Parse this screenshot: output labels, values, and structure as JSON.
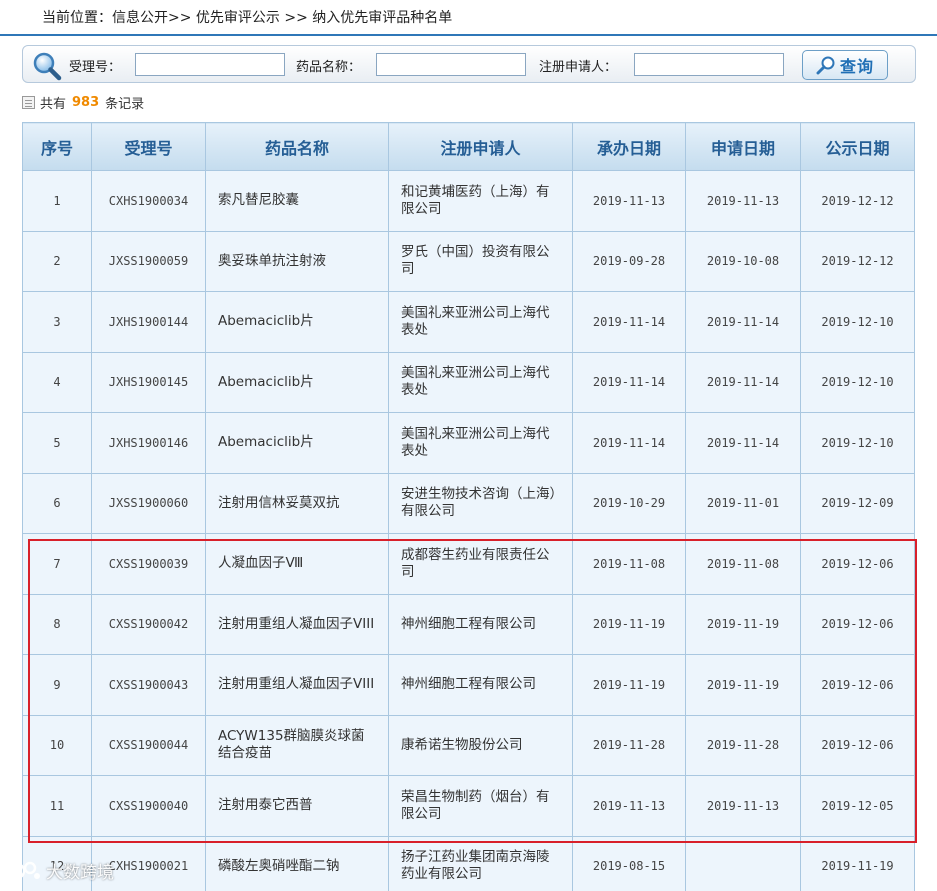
{
  "breadcrumb": "当前位置：信息公开>> 优先审评公示 >> 纳入优先审评品种名单",
  "search": {
    "accept_label": "受理号：",
    "drug_label": "药品名称：",
    "applicant_label": "注册申请人：",
    "accept_value": "",
    "drug_value": "",
    "applicant_value": "",
    "button_label": "查询"
  },
  "summary": {
    "prefix": "共有",
    "count": "983",
    "suffix": "条记录"
  },
  "table": {
    "headers": [
      "序号",
      "受理号",
      "药品名称",
      "注册申请人",
      "承办日期",
      "申请日期",
      "公示日期"
    ],
    "rows": [
      [
        "1",
        "CXHS1900034",
        "索凡替尼胶囊",
        "和记黄埔医药（上海）有限公司",
        "2019-11-13",
        "2019-11-13",
        "2019-12-12"
      ],
      [
        "2",
        "JXSS1900059",
        "奥妥珠单抗注射液",
        "罗氏（中国）投资有限公司",
        "2019-09-28",
        "2019-10-08",
        "2019-12-12"
      ],
      [
        "3",
        "JXHS1900144",
        "Abemaciclib片",
        "美国礼来亚洲公司上海代表处",
        "2019-11-14",
        "2019-11-14",
        "2019-12-10"
      ],
      [
        "4",
        "JXHS1900145",
        "Abemaciclib片",
        "美国礼来亚洲公司上海代表处",
        "2019-11-14",
        "2019-11-14",
        "2019-12-10"
      ],
      [
        "5",
        "JXHS1900146",
        "Abemaciclib片",
        "美国礼来亚洲公司上海代表处",
        "2019-11-14",
        "2019-11-14",
        "2019-12-10"
      ],
      [
        "6",
        "JXSS1900060",
        "注射用信林妥莫双抗",
        "安进生物技术咨询（上海）有限公司",
        "2019-10-29",
        "2019-11-01",
        "2019-12-09"
      ],
      [
        "7",
        "CXSS1900039",
        "人凝血因子Ⅷ",
        "成都蓉生药业有限责任公司",
        "2019-11-08",
        "2019-11-08",
        "2019-12-06"
      ],
      [
        "8",
        "CXSS1900042",
        "注射用重组人凝血因子VIII",
        "神州细胞工程有限公司",
        "2019-11-19",
        "2019-11-19",
        "2019-12-06"
      ],
      [
        "9",
        "CXSS1900043",
        "注射用重组人凝血因子VIII",
        "神州细胞工程有限公司",
        "2019-11-19",
        "2019-11-19",
        "2019-12-06"
      ],
      [
        "10",
        "CXSS1900044",
        "ACYW135群脑膜炎球菌结合疫苗",
        "康希诺生物股份公司",
        "2019-11-28",
        "2019-11-28",
        "2019-12-06"
      ],
      [
        "11",
        "CXSS1900040",
        "注射用泰它西普",
        "荣昌生物制药（烟台）有限公司",
        "2019-11-13",
        "2019-11-13",
        "2019-12-05"
      ],
      [
        "12",
        "CXHS1900021",
        "磷酸左奥硝唑酯二钠",
        "扬子江药业集团南京海陵药业有限公司",
        "2019-08-15",
        "",
        "2019-11-19"
      ]
    ]
  },
  "watermark": "大数跨境",
  "colors": {
    "header_blue": "#255e95",
    "highlight_red": "#d8202a",
    "count_orange": "#f08a00",
    "row_bg": "#edf5fc"
  }
}
